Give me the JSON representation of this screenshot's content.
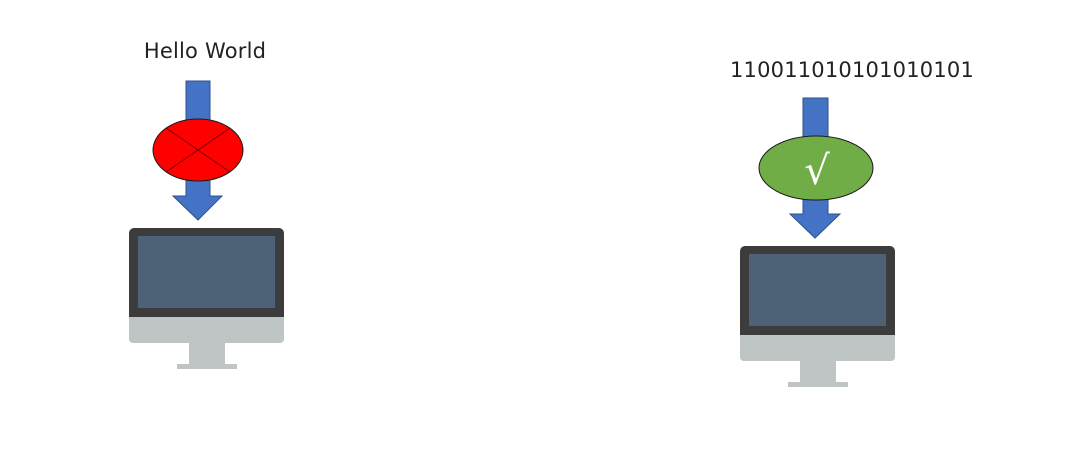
{
  "left_scene": {
    "input_text": "Hello World",
    "status": "rejected",
    "status_icon": "x-mark-icon",
    "status_color": "#ff0000"
  },
  "right_scene": {
    "input_text": "110011010101010101",
    "status": "accepted",
    "status_icon": "check-mark-icon",
    "status_symbol": "√",
    "status_color": "#70ad47"
  },
  "colors": {
    "arrow": "#4472c4",
    "monitor_bezel": "#3c3c3c",
    "monitor_screen": "#4e6277",
    "monitor_stand": "#bfc4c4"
  }
}
